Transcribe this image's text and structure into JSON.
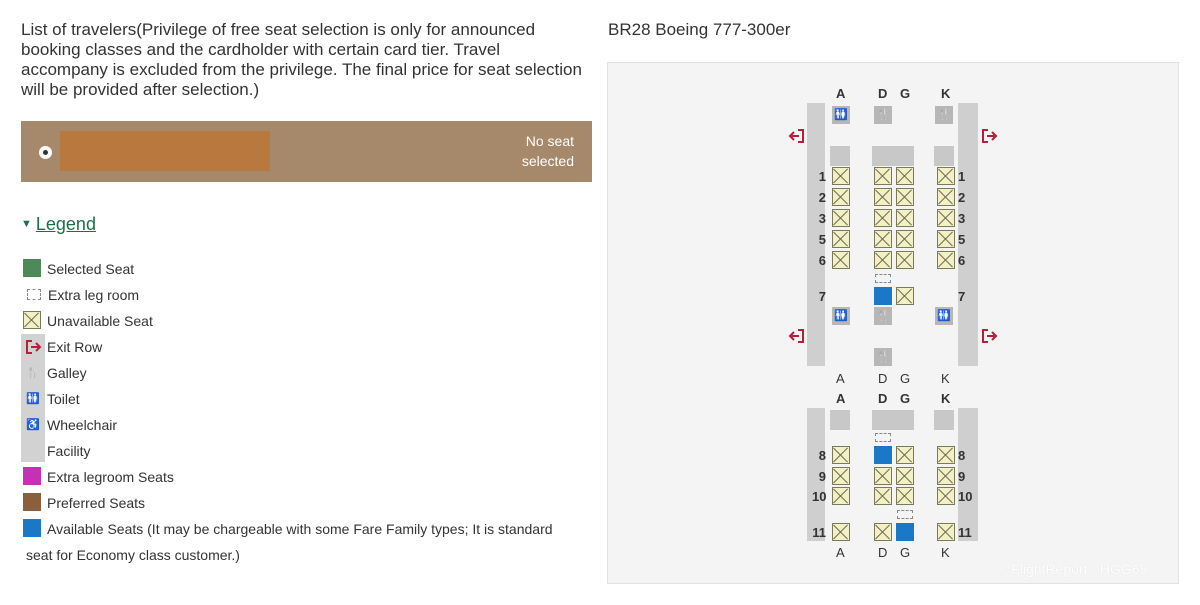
{
  "left": {
    "title": "List of travelers(Privilege of free seat selection is only for announced booking classes and the cardholder with certain card tier. Travel accompany is excluded from the privilege. The final price for seat selection will be provided after selection.)",
    "traveler": {
      "seat_status_line1": "No seat",
      "seat_status_line2": "selected"
    },
    "legend": {
      "toggle_label": "Legend",
      "items": {
        "selected": "Selected Seat",
        "extra_leg": "Extra leg room",
        "unavailable": "Unavailable Seat",
        "exit": "Exit Row",
        "galley": "Galley",
        "toilet": "Toilet",
        "wheelchair_1": "Wheelchair",
        "wheelchair_2": "Facility",
        "extra_legroom_seats": "Extra legroom Seats",
        "preferred": "Preferred Seats",
        "available_1": "Available Seats (It may be chargeable with some Fare Family types; It is standard",
        "available_2": "seat for Economy class customer.)"
      }
    }
  },
  "colors": {
    "selected": "#4d8a5a",
    "extra_legroom": "#c530b5",
    "preferred": "#8a5f3e",
    "available": "#1b78c7",
    "exit": "#b51f3a",
    "traveler_bg": "#a6886a"
  },
  "right": {
    "aircraft_title": "BR28 Boeing 777-300er",
    "columns": [
      "A",
      "D",
      "G",
      "K"
    ],
    "section1": {
      "rows": [
        {
          "row": "1",
          "seats": [
            "unavailable",
            "unavailable",
            "unavailable",
            "unavailable"
          ]
        },
        {
          "row": "2",
          "seats": [
            "unavailable",
            "unavailable",
            "unavailable",
            "unavailable"
          ]
        },
        {
          "row": "3",
          "seats": [
            "unavailable",
            "unavailable",
            "unavailable",
            "unavailable"
          ]
        },
        {
          "row": "5",
          "seats": [
            "unavailable",
            "unavailable",
            "unavailable",
            "unavailable"
          ]
        },
        {
          "row": "6",
          "seats": [
            "unavailable",
            "unavailable",
            "unavailable",
            "unavailable"
          ]
        },
        {
          "row": "7",
          "seats": [
            "none",
            "available",
            "unavailable",
            "none"
          ]
        }
      ]
    },
    "section2": {
      "rows": [
        {
          "row": "8",
          "seats": [
            "unavailable",
            "available",
            "unavailable",
            "unavailable"
          ]
        },
        {
          "row": "9",
          "seats": [
            "unavailable",
            "unavailable",
            "unavailable",
            "unavailable"
          ]
        },
        {
          "row": "10",
          "seats": [
            "unavailable",
            "unavailable",
            "unavailable",
            "unavailable"
          ]
        },
        {
          "row": "11",
          "seats": [
            "unavailable",
            "unavailable",
            "available",
            "unavailable"
          ]
        }
      ]
    },
    "facility_icons": {
      "toilet": "toilet-icon",
      "galley": "galley-icon",
      "exit": "exit-icon",
      "wheelchair": "wheelchair-icon"
    },
    "watermark": "© FlightReport · HGG65"
  }
}
